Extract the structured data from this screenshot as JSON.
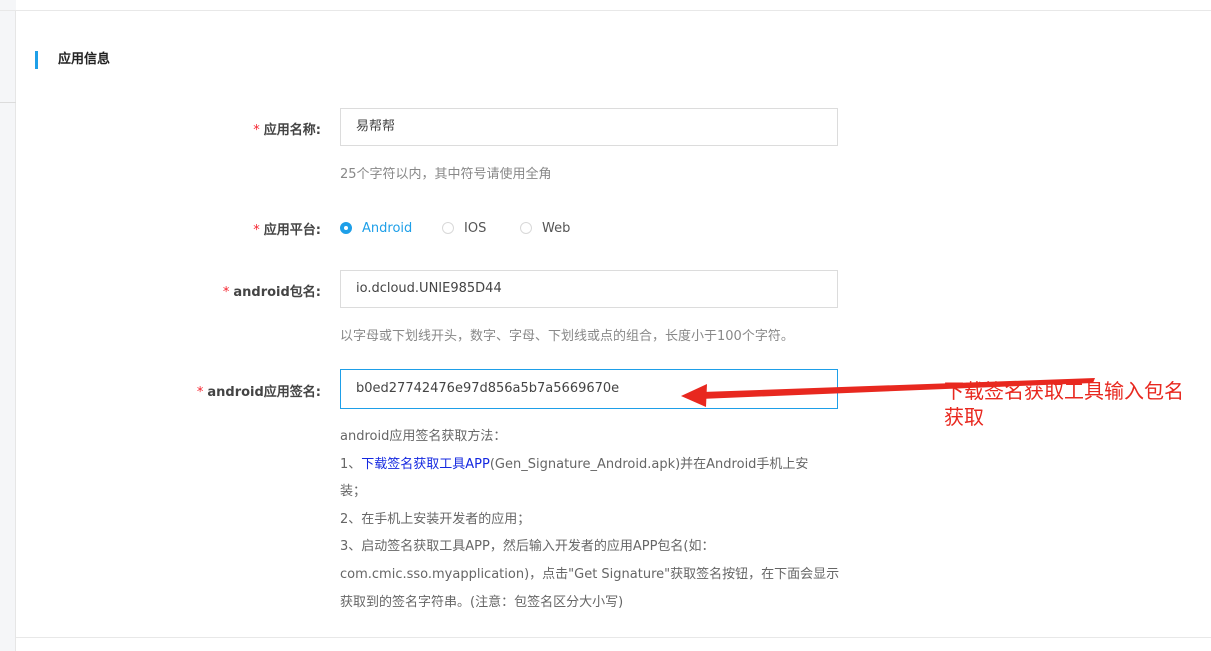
{
  "section": {
    "title": "应用信息"
  },
  "fields": {
    "app_name": {
      "required_mark": "*",
      "label": "应用名称:",
      "value": "易帮帮",
      "hint": "25个字符以内，其中符号请使用全角"
    },
    "platform": {
      "required_mark": "*",
      "label": "应用平台:",
      "options": [
        "Android",
        "IOS",
        "Web"
      ],
      "selected": "Android"
    },
    "package_name": {
      "required_mark": "*",
      "label": "android包名:",
      "value": "io.dcloud.UNIE985D44",
      "hint": "以字母或下划线开头，数字、字母、下划线或点的组合，长度小于100个字符。"
    },
    "signature": {
      "required_mark": "*",
      "label": "android应用签名:",
      "value": "b0ed27742476e97d856a5b7a5669670e"
    }
  },
  "help": {
    "title": "android应用签名获取方法：",
    "step1_prefix": "1、",
    "step1_link": "下载签名获取工具APP",
    "step1_suffix": "(Gen_Signature_Android.apk)并在Android手机上安",
    "step1_wrap": "装；",
    "step2": "2、在手机上安装开发者的应用；",
    "step3_line1": "3、启动签名获取工具APP，然后输入开发者的应用APP包名(如：",
    "step3_line2": "com.cmic.sso.myapplication)，点击\"Get Signature\"获取签名按钮，在下面会显示",
    "step3_line3": "获取到的签名字符串。(注意：包签名区分大小写)"
  },
  "annotation": {
    "line1": "下载签名获取工具输入包名",
    "line2": "获取",
    "color": "#e8281f"
  },
  "colors": {
    "accent": "#1e9fe8",
    "required": "#f5222d",
    "link": "#1428e0"
  }
}
